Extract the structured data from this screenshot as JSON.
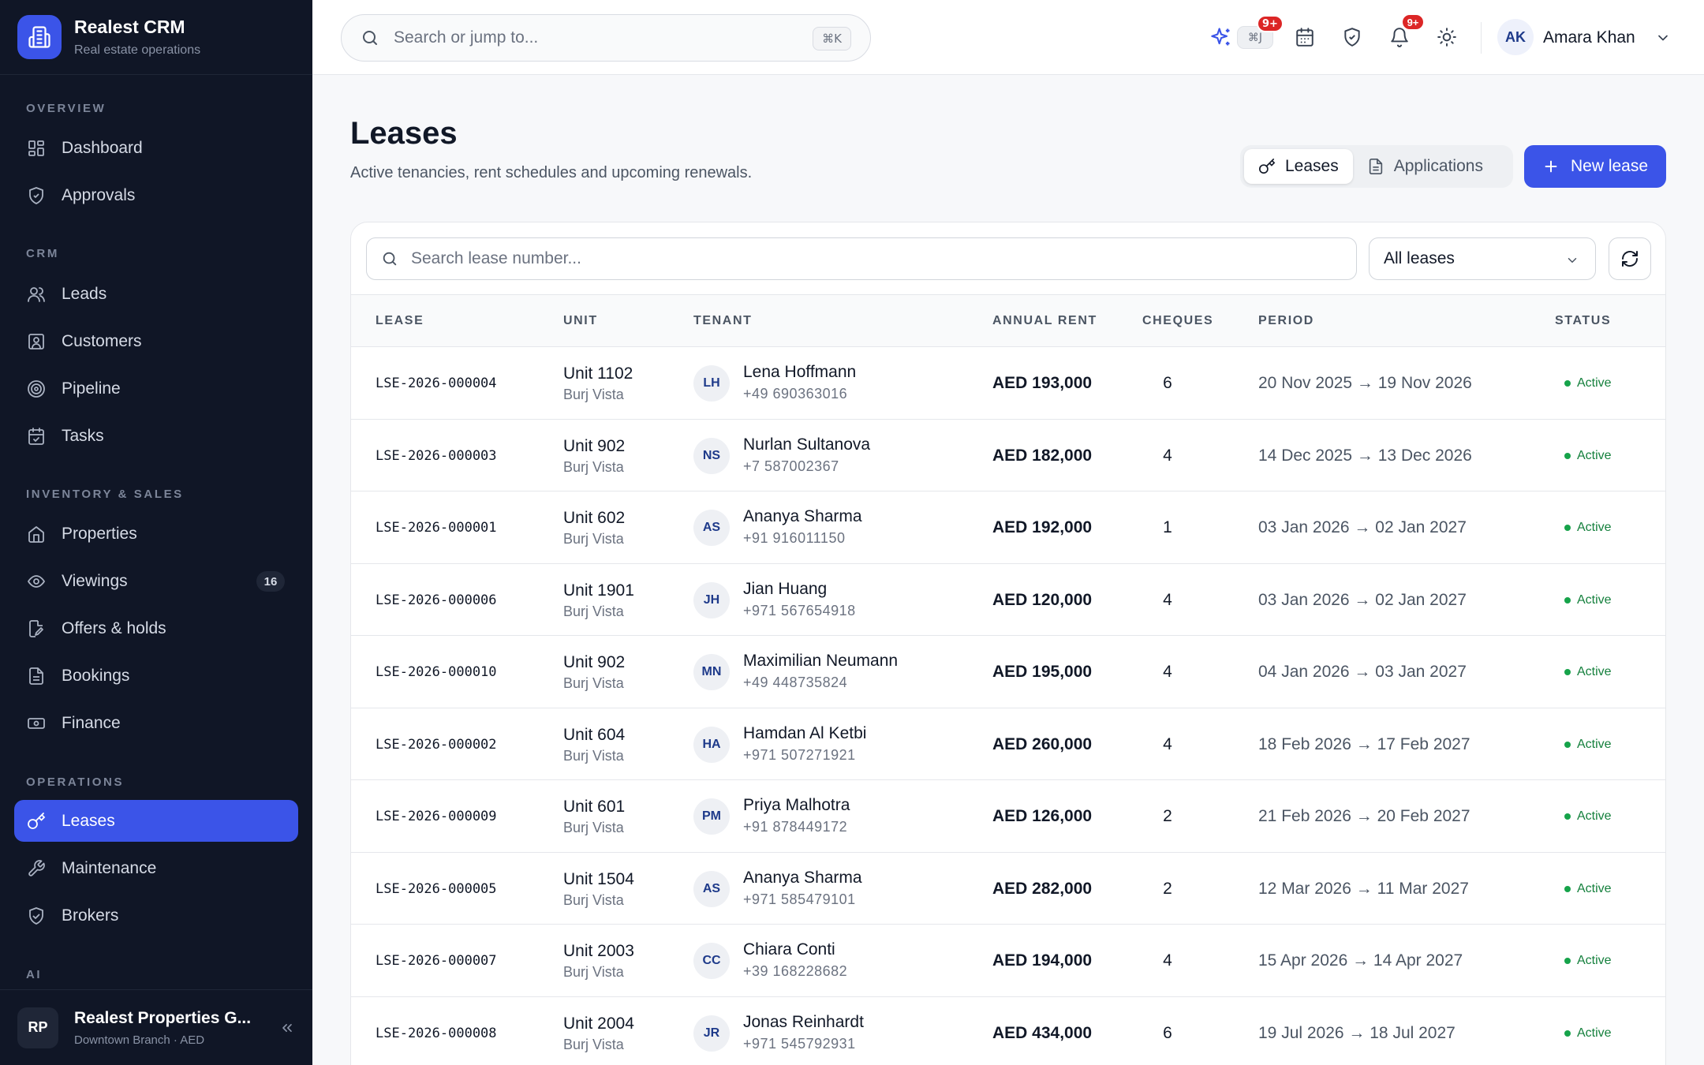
{
  "brand": {
    "name": "Realest CRM",
    "subtitle": "Real estate operations"
  },
  "sidebar": {
    "sections": {
      "overview": "OVERVIEW",
      "crm": "CRM",
      "inventory": "INVENTORY & SALES",
      "operations": "OPERATIONS",
      "ai": "AI"
    },
    "items": {
      "dashboard": "Dashboard",
      "approvals": "Approvals",
      "leads": "Leads",
      "customers": "Customers",
      "pipeline": "Pipeline",
      "tasks": "Tasks",
      "properties": "Properties",
      "viewings": "Viewings",
      "viewings_badge": "16",
      "offers": "Offers & holds",
      "bookings": "Bookings",
      "finance": "Finance",
      "leases": "Leases",
      "maintenance": "Maintenance",
      "brokers": "Brokers"
    },
    "org": {
      "initials": "RP",
      "name": "Realest Properties G...",
      "sub": "Downtown Branch · AED"
    }
  },
  "topbar": {
    "search_placeholder": "Search or jump to...",
    "search_kbd": "⌘K",
    "ai_kbd": "⌘J",
    "ai_badge": "9+",
    "notif_badge": "9+",
    "user_initials": "AK",
    "user_name": "Amara Khan"
  },
  "header": {
    "title": "Leases",
    "subtitle": "Active tenancies, rent schedules and upcoming renewals.",
    "tab_leases": "Leases",
    "tab_applications": "Applications",
    "new_button": "New lease"
  },
  "filters": {
    "search_placeholder": "Search lease number...",
    "select_value": "All leases"
  },
  "table": {
    "headers": {
      "lease": "LEASE",
      "unit": "UNIT",
      "tenant": "TENANT",
      "rent": "ANNUAL RENT",
      "cheques": "CHEQUES",
      "period": "PERIOD",
      "status": "STATUS"
    },
    "rows": [
      {
        "lease": "LSE-2026-000004",
        "unit": "Unit 1102",
        "building": "Burj Vista",
        "initials": "LH",
        "tenant": "Lena Hoffmann",
        "phone": "+49 690363016",
        "rent": "AED 193,000",
        "cheques": "6",
        "period": "20 Nov 2025 → 19 Nov 2026",
        "status": "Active"
      },
      {
        "lease": "LSE-2026-000003",
        "unit": "Unit 902",
        "building": "Burj Vista",
        "initials": "NS",
        "tenant": "Nurlan Sultanova",
        "phone": "+7 587002367",
        "rent": "AED 182,000",
        "cheques": "4",
        "period": "14 Dec 2025 → 13 Dec 2026",
        "status": "Active"
      },
      {
        "lease": "LSE-2026-000001",
        "unit": "Unit 602",
        "building": "Burj Vista",
        "initials": "AS",
        "tenant": "Ananya Sharma",
        "phone": "+91 916011150",
        "rent": "AED 192,000",
        "cheques": "1",
        "period": "03 Jan 2026 → 02 Jan 2027",
        "status": "Active"
      },
      {
        "lease": "LSE-2026-000006",
        "unit": "Unit 1901",
        "building": "Burj Vista",
        "initials": "JH",
        "tenant": "Jian Huang",
        "phone": "+971 567654918",
        "rent": "AED 120,000",
        "cheques": "4",
        "period": "03 Jan 2026 → 02 Jan 2027",
        "status": "Active"
      },
      {
        "lease": "LSE-2026-000010",
        "unit": "Unit 902",
        "building": "Burj Vista",
        "initials": "MN",
        "tenant": "Maximilian Neumann",
        "phone": "+49 448735824",
        "rent": "AED 195,000",
        "cheques": "4",
        "period": "04 Jan 2026 → 03 Jan 2027",
        "status": "Active"
      },
      {
        "lease": "LSE-2026-000002",
        "unit": "Unit 604",
        "building": "Burj Vista",
        "initials": "HA",
        "tenant": "Hamdan Al Ketbi",
        "phone": "+971 507271921",
        "rent": "AED 260,000",
        "cheques": "4",
        "period": "18 Feb 2026 → 17 Feb 2027",
        "status": "Active"
      },
      {
        "lease": "LSE-2026-000009",
        "unit": "Unit 601",
        "building": "Burj Vista",
        "initials": "PM",
        "tenant": "Priya Malhotra",
        "phone": "+91 878449172",
        "rent": "AED 126,000",
        "cheques": "2",
        "period": "21 Feb 2026 → 20 Feb 2027",
        "status": "Active"
      },
      {
        "lease": "LSE-2026-000005",
        "unit": "Unit 1504",
        "building": "Burj Vista",
        "initials": "AS",
        "tenant": "Ananya Sharma",
        "phone": "+971 585479101",
        "rent": "AED 282,000",
        "cheques": "2",
        "period": "12 Mar 2026 → 11 Mar 2027",
        "status": "Active"
      },
      {
        "lease": "LSE-2026-000007",
        "unit": "Unit 2003",
        "building": "Burj Vista",
        "initials": "CC",
        "tenant": "Chiara Conti",
        "phone": "+39 168228682",
        "rent": "AED 194,000",
        "cheques": "4",
        "period": "15 Apr 2026 → 14 Apr 2027",
        "status": "Active"
      },
      {
        "lease": "LSE-2026-000008",
        "unit": "Unit 2004",
        "building": "Burj Vista",
        "initials": "JR",
        "tenant": "Jonas Reinhardt",
        "phone": "+971 545792931",
        "rent": "AED 434,000",
        "cheques": "6",
        "period": "19 Jul 2026 → 18 Jul 2027",
        "status": "Active"
      }
    ]
  }
}
